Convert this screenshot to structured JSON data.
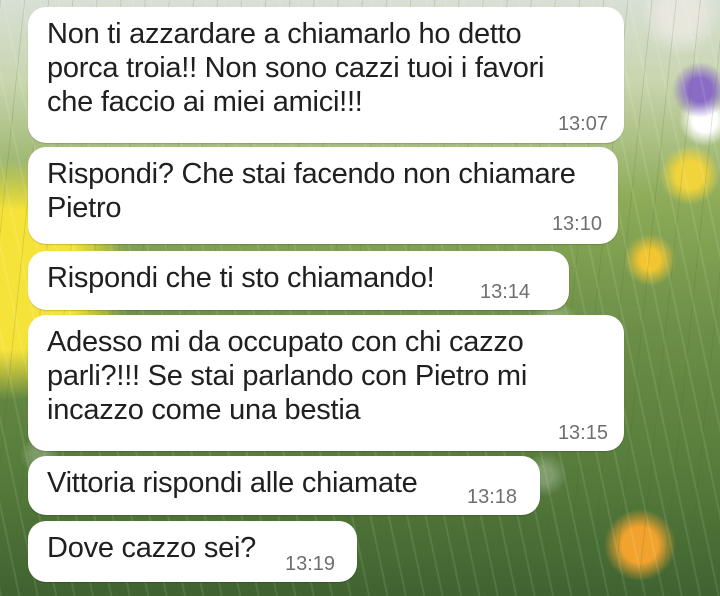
{
  "messages": [
    {
      "text": "Non ti azzardare a chiamarlo ho detto\nporca troia!! Non sono cazzi tuoi i favori\nche faccio ai miei amici!!!",
      "time": "13:07"
    },
    {
      "text": "Rispondi? Che stai facendo non chiamare\nPietro",
      "time": "13:10"
    },
    {
      "text": "Rispondi che ti sto chiamando!",
      "time": "13:14"
    },
    {
      "text": "Adesso mi da occupato con chi cazzo\nparli?!!! Se stai parlando con Pietro mi\nincazzo come una bestia",
      "time": "13:15"
    },
    {
      "text": "Vittoria rispondi alle chiamate",
      "time": "13:18"
    },
    {
      "text": "Dove cazzo sei?",
      "time": "13:19"
    }
  ]
}
